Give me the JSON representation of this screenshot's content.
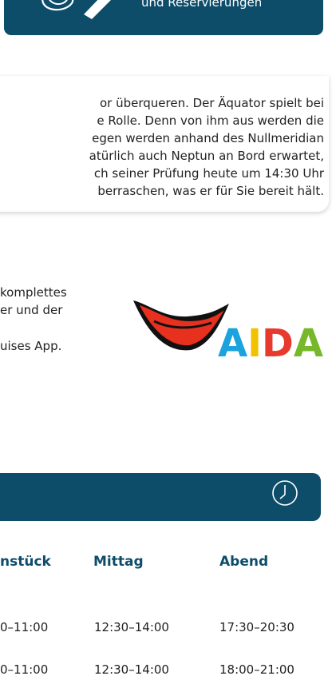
{
  "top_banner": {
    "label": "und Reservierungen"
  },
  "info_card": {
    "lines": [
      "or überqueren. Der Äquator spielt bei",
      "e Rolle. Denn von ihm aus werden die",
      "egen werden anhand des Nullmeridian",
      "atürlich auch Neptun an Bord erwartet,",
      "ch seiner Prüfung heute um 14:30 Uhr",
      "berraschen, was er für Sie bereit hält."
    ]
  },
  "app_promo": {
    "lines": [
      "komplettes",
      "er und der",
      "uises App."
    ]
  },
  "logo": {
    "text": "AIDA",
    "letter_colors": [
      "#1aa3dc",
      "#f2c100",
      "#e8392d",
      "#77b82a"
    ],
    "lips_color": "#e8301f"
  },
  "hours": {
    "columns": [
      "nstück",
      "Mittag",
      "Abend"
    ],
    "rows": [
      [
        "0–11:00",
        "12:30–14:00",
        "17:30–20:30"
      ],
      [
        "0–11:00",
        "12:30–14:00",
        "18:00–21:00"
      ]
    ]
  },
  "colors": {
    "navy": "#0d4d6a",
    "text": "#222222"
  },
  "icons": {
    "banner": "phone-icon",
    "hours": "clock-icon"
  }
}
